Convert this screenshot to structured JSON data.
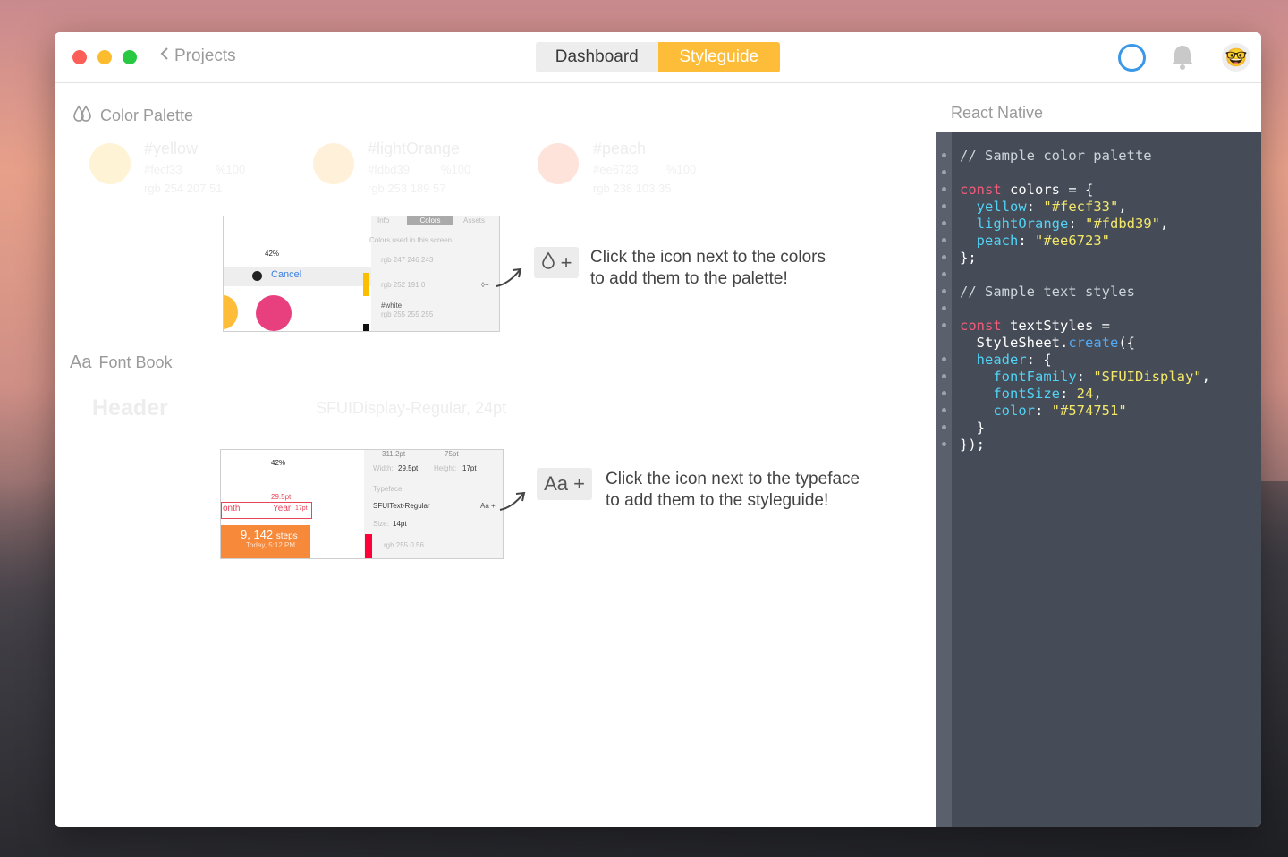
{
  "titlebar": {
    "back_label": "Projects",
    "tabs": [
      {
        "label": "Dashboard",
        "active": false
      },
      {
        "label": "Styleguide",
        "active": true
      }
    ]
  },
  "color_palette": {
    "title": "Color Palette",
    "colors": [
      {
        "name": "#yellow",
        "hex": "#fecf33",
        "opacity": "%100",
        "rgb": "rgb 254 207 51",
        "swatch": "#fff3d6"
      },
      {
        "name": "#lightOrange",
        "hex": "#fdbd39",
        "opacity": "%100",
        "rgb": "rgb 253 189 57",
        "swatch": "#fff1d9"
      },
      {
        "name": "#peach",
        "hex": "#ee6723",
        "opacity": "%100",
        "rgb": "rgb 238 103 35",
        "swatch": "#fde3da"
      }
    ],
    "screenshot": {
      "tabs": [
        "Info",
        "Colors",
        "Assets"
      ],
      "caption": "Colors used in this screen",
      "battery": "42%",
      "cancel": "Cancel",
      "rows": [
        "rgb 247 246 243",
        "rgb 252 191 0",
        "#white",
        "rgb 255 255 255"
      ]
    },
    "add_button": "+",
    "hint_line1": "Click the icon next to the colors",
    "hint_line2": "to add them to the palette!"
  },
  "font_book": {
    "title": "Font Book",
    "title_prefix": "Aa",
    "sample_name": "Header",
    "sample_spec": "SFUIDisplay-Regular, 24pt",
    "screenshot": {
      "battery": "42%",
      "top": "311.2pt",
      "top2": "75pt",
      "width_label": "Width:",
      "width_value": "29.5pt",
      "height_label": "Height:",
      "height_value": "17pt",
      "typeface_label": "Typeface",
      "typeface_value": "SFUIText-Regular",
      "size_label": "Size:",
      "size_value": "14pt",
      "color_value": "rgb 255 0 56",
      "month": "onth",
      "year": "Year",
      "dim1": "29.5pt",
      "dim2": "17pt",
      "steps": "9, 142",
      "steps_unit": "steps",
      "steps_time": "Today, 5:12 PM",
      "aa_small": "Aa +"
    },
    "add_button": "Aa +",
    "hint_line1": "Click the icon next to the typeface",
    "hint_line2": "to add them to the styleguide!"
  },
  "code_panel": {
    "title": "React Native"
  }
}
